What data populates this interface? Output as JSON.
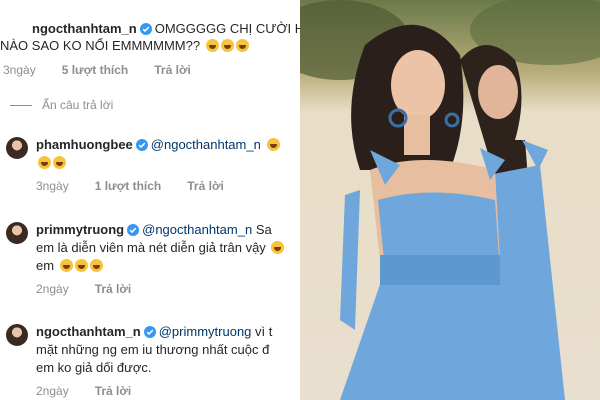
{
  "comments": [
    {
      "username": "ngocthanhtam_n",
      "text_line1": "OMGGGGG CHỊ CƯỜI HO",
      "text_line2": "NÀO SAO KO NỔI EMMMMMM??",
      "time": "3ngày",
      "likes": "5 lượt thích",
      "reply": "Trả lời"
    },
    {
      "username": "phamhuongbee",
      "mention": "@ngocthanhtam_n",
      "time": "3ngày",
      "likes": "1 lượt thích",
      "reply": "Trả lời"
    },
    {
      "username": "primmytruong",
      "mention": "@ngocthanhtam_n",
      "text_line1_end": "Sa",
      "text_line2": "em là diễn viên mà nét diễn giả trân vậy",
      "text_line3": "em",
      "time": "2ngày",
      "reply": "Trả lời"
    },
    {
      "username": "ngocthanhtam_n",
      "mention": "@primmytruong",
      "text_line1_end": "vì t",
      "text_line2": "mặt những ng em iu thương nhất cuộc đ",
      "text_line3": "em ko giả dối được.",
      "time": "2ngày",
      "reply": "Trả lời"
    }
  ],
  "hide_replies": "Ẩn câu trả lời",
  "icons": [
    "verified-badge-icon",
    "crying-laughing-emoji-icon"
  ],
  "colors": {
    "username": "#262626",
    "mention": "#00376b",
    "meta": "#8e8e8e",
    "verified": "#3897f0",
    "dress": "#6fa7dc"
  }
}
